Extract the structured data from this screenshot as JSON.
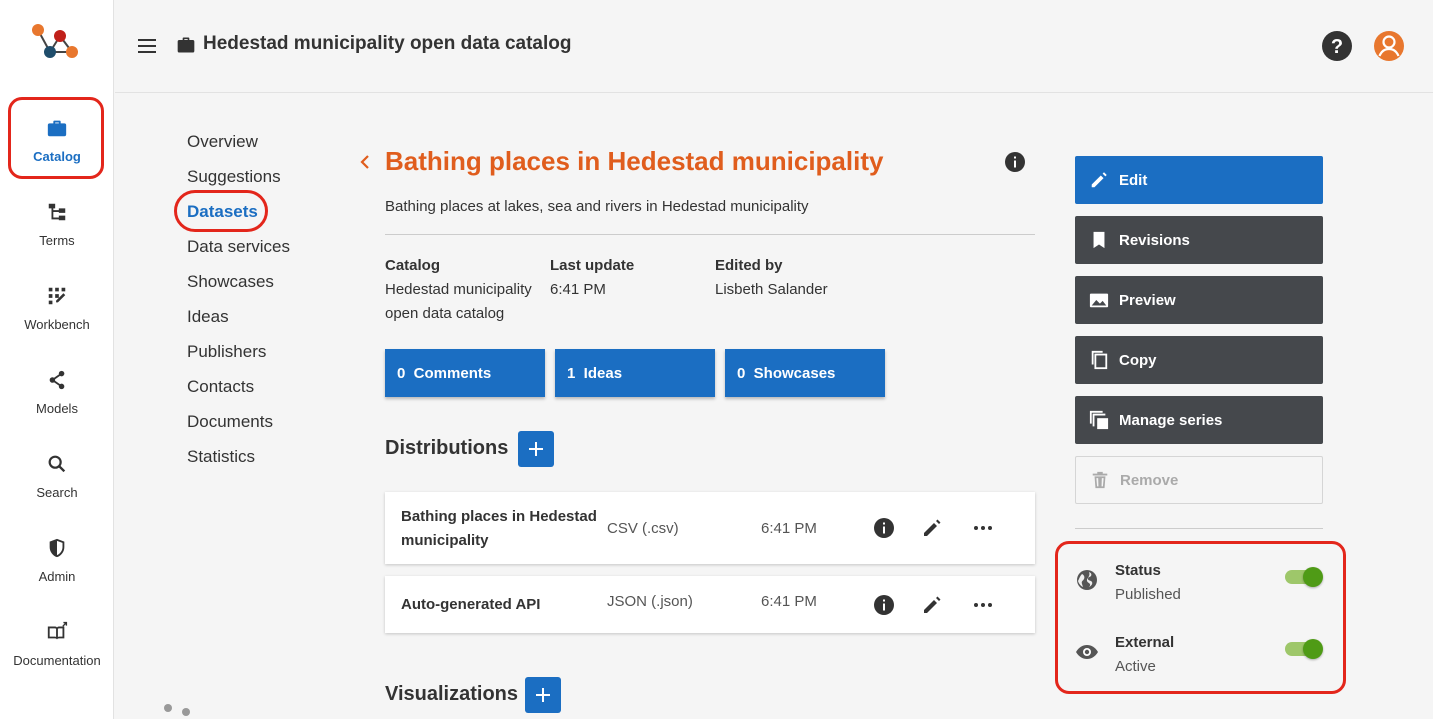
{
  "header": {
    "title": "Hedestad municipality open data catalog"
  },
  "rail": {
    "items": [
      {
        "label": "Catalog",
        "icon": "briefcase-icon"
      },
      {
        "label": "Terms",
        "icon": "hierarchy-icon"
      },
      {
        "label": "Workbench",
        "icon": "workbench-icon"
      },
      {
        "label": "Models",
        "icon": "share-icon"
      },
      {
        "label": "Search",
        "icon": "search-icon"
      },
      {
        "label": "Admin",
        "icon": "shield-icon"
      },
      {
        "label": "Documentation",
        "icon": "book-external-icon"
      }
    ]
  },
  "subnav": {
    "items": [
      "Overview",
      "Suggestions",
      "Datasets",
      "Data services",
      "Showcases",
      "Ideas",
      "Publishers",
      "Contacts",
      "Documents",
      "Statistics"
    ],
    "active": "Datasets"
  },
  "dataset": {
    "title": "Bathing places in Hedestad municipality",
    "description": "Bathing places at lakes, sea and rivers in Hedestad municipality",
    "meta": {
      "catalog_label": "Catalog",
      "catalog_value_line1": "Hedestad municipality",
      "catalog_value_line2": "open data catalog",
      "update_label": "Last update",
      "update_value": "6:41 PM",
      "editor_label": "Edited by",
      "editor_value": "Lisbeth Salander"
    },
    "counts": {
      "comments": "0  Comments",
      "ideas": "1  Ideas",
      "showcases": "0  Showcases"
    }
  },
  "distributions": {
    "title": "Distributions",
    "rows": [
      {
        "name": "Bathing places in Hedestad municipality",
        "format": "CSV (.csv)",
        "time": "6:41 PM"
      },
      {
        "name": "Auto-generated API",
        "format": "JSON (.json)",
        "time": "6:41 PM"
      }
    ]
  },
  "visualizations": {
    "title": "Visualizations"
  },
  "actions": {
    "edit": "Edit",
    "revisions": "Revisions",
    "preview": "Preview",
    "copy": "Copy",
    "manage_series": "Manage series",
    "remove": "Remove"
  },
  "status": {
    "status_label": "Status",
    "status_value": "Published",
    "external_label": "External",
    "external_value": "Active",
    "status_on": true,
    "external_on": true
  },
  "colors": {
    "accent": "#1b6ec2",
    "title_orange": "#e05d1d",
    "highlight_red": "#e3261b",
    "toggle_green": "#4f9b16"
  }
}
